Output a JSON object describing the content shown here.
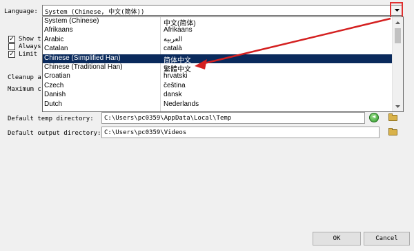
{
  "language": {
    "label": "Language:",
    "current_value": "System (Chinese, 中文(简体))",
    "options": [
      {
        "name": "System (Chinese)",
        "native": "中文(简体)"
      },
      {
        "name": "Afrikaans",
        "native": "Afrikaans"
      },
      {
        "name": "Arabic",
        "native": "العربية"
      },
      {
        "name": "Catalan",
        "native": "català"
      },
      {
        "name": "Chinese (Simplified Han)",
        "native": "简体中文"
      },
      {
        "name": "Chinese (Traditional Han)",
        "native": "繁體中文"
      },
      {
        "name": "Croatian",
        "native": "hrvatski"
      },
      {
        "name": "Czech",
        "native": "čeština"
      },
      {
        "name": "Danish",
        "native": "dansk"
      },
      {
        "name": "Dutch",
        "native": "Nederlands"
      }
    ],
    "selected_index": 4
  },
  "options_partial": {
    "show_label": "Show t",
    "always_label": "Always",
    "limit_label": "Limit",
    "show_checked": true,
    "always_checked": false,
    "limit_checked": true,
    "cleanup_label": "Cleanup a",
    "maximum_label": "Maximum c"
  },
  "directories": {
    "temp_label": "Default temp directory:",
    "temp_value": "C:\\Users\\pc0359\\AppData\\Local\\Temp",
    "output_label": "Default output directory:",
    "output_value": "C:\\Users\\pc0359\\Videos"
  },
  "buttons": {
    "ok": "OK",
    "cancel": "Cancel"
  },
  "icons": {
    "dropdown": "chevron-down-icon",
    "folder": "folder-icon",
    "refresh": "green-circle-icon"
  },
  "colors": {
    "highlight": "#e03030",
    "selection": "#0a2a5c"
  }
}
